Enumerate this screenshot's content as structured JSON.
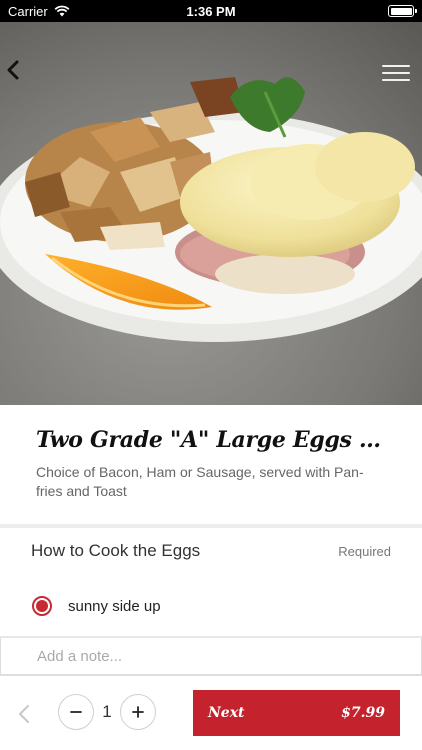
{
  "status_bar": {
    "carrier": "Carrier",
    "time": "1:36 PM"
  },
  "header": {
    "back_icon": "chevron-left-icon",
    "menu_icon": "hamburger-menu-icon"
  },
  "item": {
    "title": "Two Grade \"A\" Large Eggs With...",
    "description": "Choice of Bacon, Ham or Sausage, served with Pan-fries and Toast"
  },
  "option_group": {
    "title": "How to Cook the Eggs",
    "required_label": "Required",
    "options": [
      {
        "label": "sunny side up",
        "selected": true
      }
    ]
  },
  "note": {
    "placeholder": "Add a note..."
  },
  "footer": {
    "quantity": "1",
    "next_label": "Next",
    "price": "$7.99"
  },
  "colors": {
    "accent": "#c4232d",
    "divider": "#ececec"
  }
}
